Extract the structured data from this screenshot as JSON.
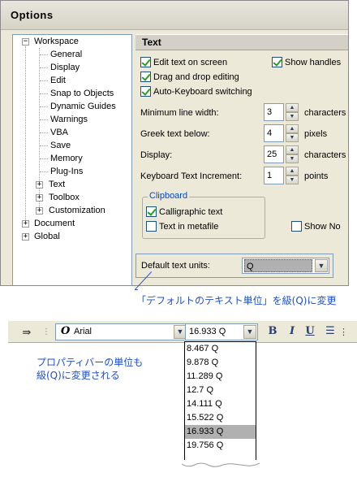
{
  "dialog": {
    "title": "Options",
    "tree": {
      "workspace": "Workspace",
      "children": [
        "General",
        "Display",
        "Edit",
        "Snap to Objects",
        "Dynamic Guides",
        "Warnings",
        "VBA",
        "Save",
        "Memory",
        "Plug-Ins",
        "Text",
        "Toolbox",
        "Customization"
      ],
      "document": "Document",
      "global": "Global"
    },
    "panel": {
      "header": "Text",
      "edit_text_on_screen": "Edit text on screen",
      "drag_and_drop": "Drag and drop editing",
      "auto_keyboard": "Auto-Keyboard switching",
      "show_handles": "Show handles",
      "fields": [
        {
          "label": "Minimum line width:",
          "value": "3",
          "unit": "characters"
        },
        {
          "label": "Greek text below:",
          "value": "4",
          "unit": "pixels"
        },
        {
          "label": "Display:",
          "value": "25",
          "unit": "characters"
        },
        {
          "label": "Keyboard Text Increment:",
          "value": "1",
          "unit": "points"
        }
      ],
      "clipboard": {
        "label": "Clipboard",
        "calligraphic": "Calligraphic text",
        "metafile": "Text in metafile"
      },
      "show_non": "Show No",
      "default_units_label": "Default text units:",
      "default_units_value": "Q"
    }
  },
  "callout": "「デフォルトのテキスト単位」を級(Q)に変更",
  "property_bar": {
    "font_name": "Arial",
    "font_glyph": "O",
    "size_value": "16.933 Q",
    "bold": "B",
    "italic": "I",
    "underline": "U"
  },
  "dropdown": {
    "items": [
      "8.467 Q",
      "9.878 Q",
      "11.289 Q",
      "12.7 Q",
      "14.111 Q",
      "15.522 Q",
      "16.933 Q",
      "19.756 Q"
    ],
    "selected_index": 6
  },
  "note": [
    "プロパティバーの単位も",
    "級(Q)に変更される"
  ],
  "colors": {
    "annotation": "#1f4fd1",
    "check": "#21a121"
  }
}
